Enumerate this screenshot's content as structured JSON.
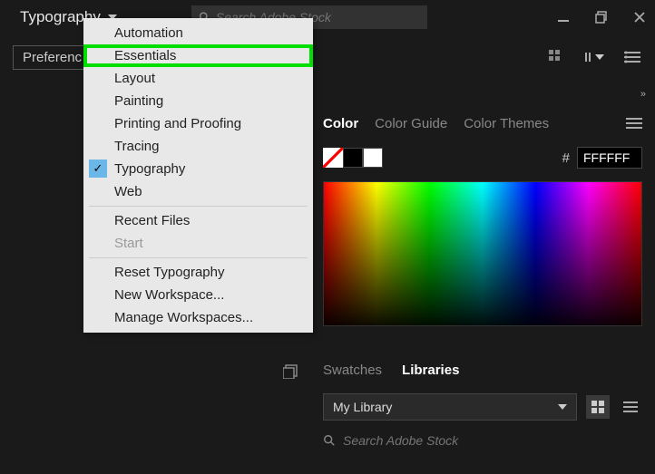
{
  "topbar": {
    "workspace_label": "Typography",
    "search_placeholder": "Search Adobe Stock"
  },
  "secondbar": {
    "preferences_label": "Preferenc"
  },
  "dropdown": {
    "items": [
      {
        "label": "Automation",
        "type": "item"
      },
      {
        "label": "Essentials",
        "type": "item",
        "highlighted": true
      },
      {
        "label": "Layout",
        "type": "item"
      },
      {
        "label": "Painting",
        "type": "item"
      },
      {
        "label": "Printing and Proofing",
        "type": "item"
      },
      {
        "label": "Tracing",
        "type": "item"
      },
      {
        "label": "Typography",
        "type": "item",
        "checked": true
      },
      {
        "label": "Web",
        "type": "item"
      },
      {
        "type": "sep"
      },
      {
        "label": "Recent Files",
        "type": "item"
      },
      {
        "label": "Start",
        "type": "item",
        "disabled": true
      },
      {
        "type": "sep"
      },
      {
        "label": "Reset Typography",
        "type": "item"
      },
      {
        "label": "New Workspace...",
        "type": "item"
      },
      {
        "label": "Manage Workspaces...",
        "type": "item"
      }
    ]
  },
  "color_panel": {
    "tabs": {
      "color": "Color",
      "guide": "Color Guide",
      "themes": "Color Themes"
    },
    "hash": "#",
    "hex": "FFFFFF"
  },
  "lib_panel": {
    "tabs": {
      "swatches": "Swatches",
      "libraries": "Libraries"
    },
    "selected": "My Library",
    "search_placeholder": "Search Adobe Stock"
  }
}
